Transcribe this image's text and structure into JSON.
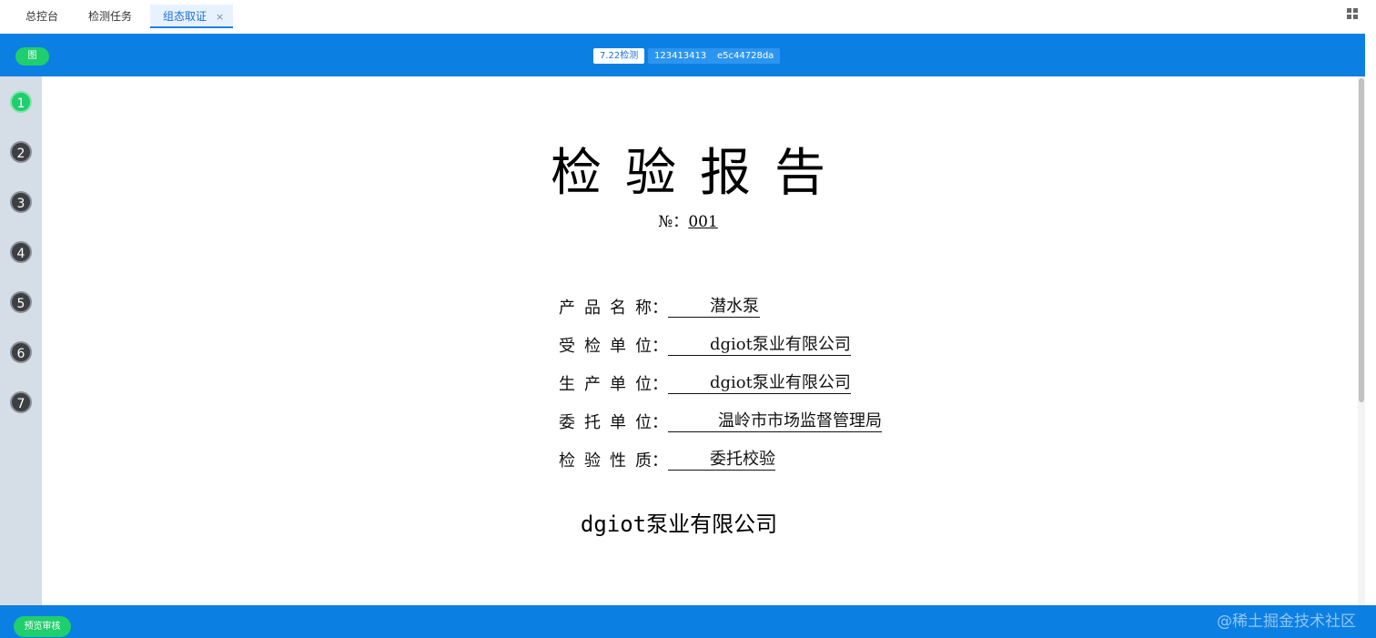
{
  "tabs": [
    {
      "label": "总控台"
    },
    {
      "label": "检测任务"
    },
    {
      "label": "组态取证",
      "close": "×"
    }
  ],
  "header": {
    "pill_label": "图",
    "tags": [
      "7.22检测",
      "123413413",
      "e5c44728da"
    ]
  },
  "steps": [
    "1",
    "2",
    "3",
    "4",
    "5",
    "6",
    "7"
  ],
  "report": {
    "title": "检验报告",
    "number_label": "№：",
    "number_value": "001",
    "fields": [
      {
        "label": "产品名称",
        "value": "潜水泵"
      },
      {
        "label": "受检单位",
        "value": "dgiot泵业有限公司"
      },
      {
        "label": "生产单位",
        "value": "dgiot泵业有限公司"
      },
      {
        "label": "委托单位",
        "value": "温岭市市场监督管理局"
      },
      {
        "label": "检验性质",
        "value": "委托校验"
      }
    ],
    "colon": "：",
    "company": "dgiot泵业有限公司"
  },
  "footer": {
    "preview_label": "预览审核",
    "watermark": "@稀土掘金技术社区"
  },
  "colors": {
    "primary_blue": "#0c7fe3",
    "green": "#1fce6d",
    "rail": "#d5dde6"
  }
}
